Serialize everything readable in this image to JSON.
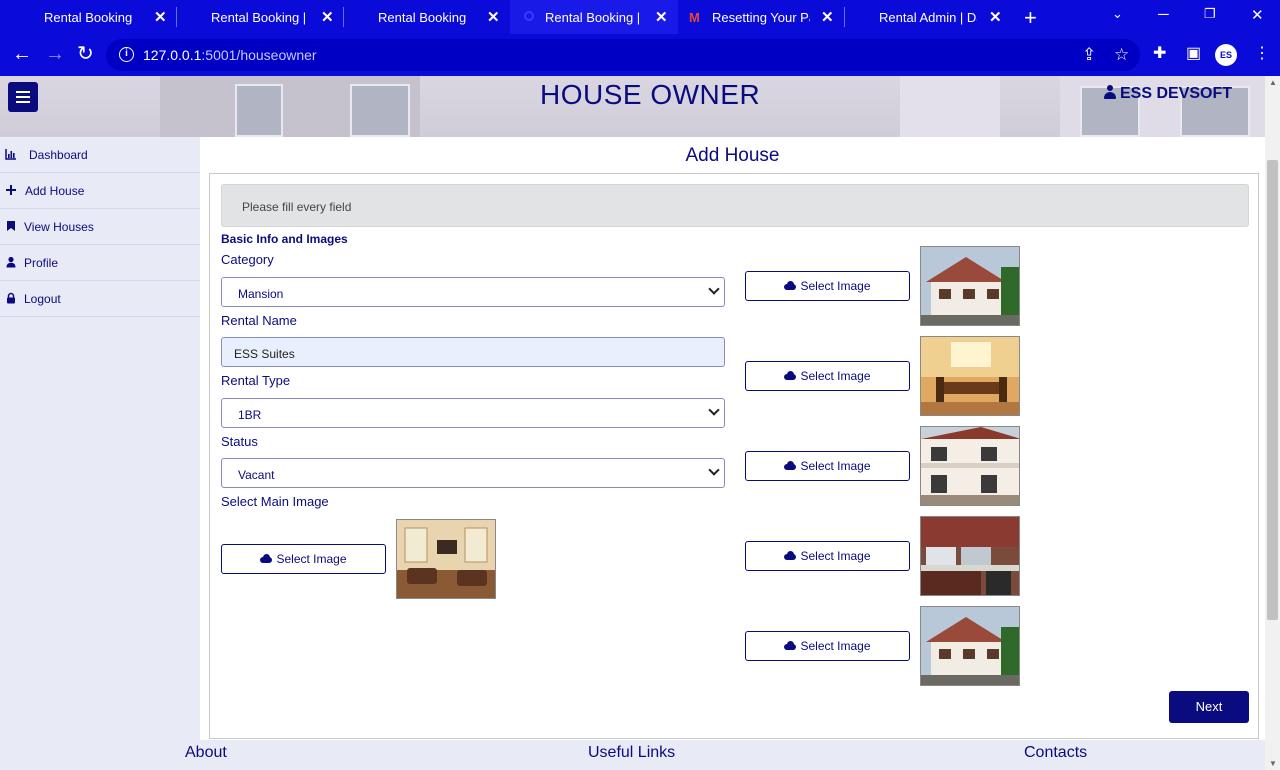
{
  "browser": {
    "tabs": [
      {
        "title": "Rental Booking"
      },
      {
        "title": "Rental Booking | Po"
      },
      {
        "title": "Rental Booking"
      },
      {
        "title": "Rental Booking | H"
      },
      {
        "title": "Resetting Your Pas"
      },
      {
        "title": "Rental Admin | Das"
      }
    ],
    "url_host": "127.0.0.1",
    "url_path": ":5001/houseowner",
    "profile_initials": "ES"
  },
  "header": {
    "title": "HOUSE OWNER",
    "user": "ESS DEVSOFT"
  },
  "sidebar": {
    "items": [
      {
        "label": "Dashboard",
        "icon": "chart-icon"
      },
      {
        "label": "Add House",
        "icon": "plus-icon"
      },
      {
        "label": "View Houses",
        "icon": "bookmark-icon"
      },
      {
        "label": "Profile",
        "icon": "user-icon"
      },
      {
        "label": "Logout",
        "icon": "lock-icon"
      }
    ]
  },
  "main": {
    "title": "Add House",
    "alert": "Please fill every field",
    "section_title": "Basic Info and Images",
    "fields": {
      "category": {
        "label": "Category",
        "value": "Mansion"
      },
      "rental_name": {
        "label": "Rental Name",
        "value": "ESS Suites"
      },
      "rental_type": {
        "label": "Rental Type",
        "value": "1BR"
      },
      "status": {
        "label": "Status",
        "value": "Vacant"
      },
      "main_image": {
        "label": "Select Main Image"
      }
    },
    "select_image_label": "Select Image",
    "next_label": "Next"
  },
  "footer": {
    "about": "About",
    "useful_links": "Useful Links",
    "contacts": "Contacts"
  },
  "colors": {
    "brand": "#0b0b80",
    "browser": "#0a0ad9"
  }
}
